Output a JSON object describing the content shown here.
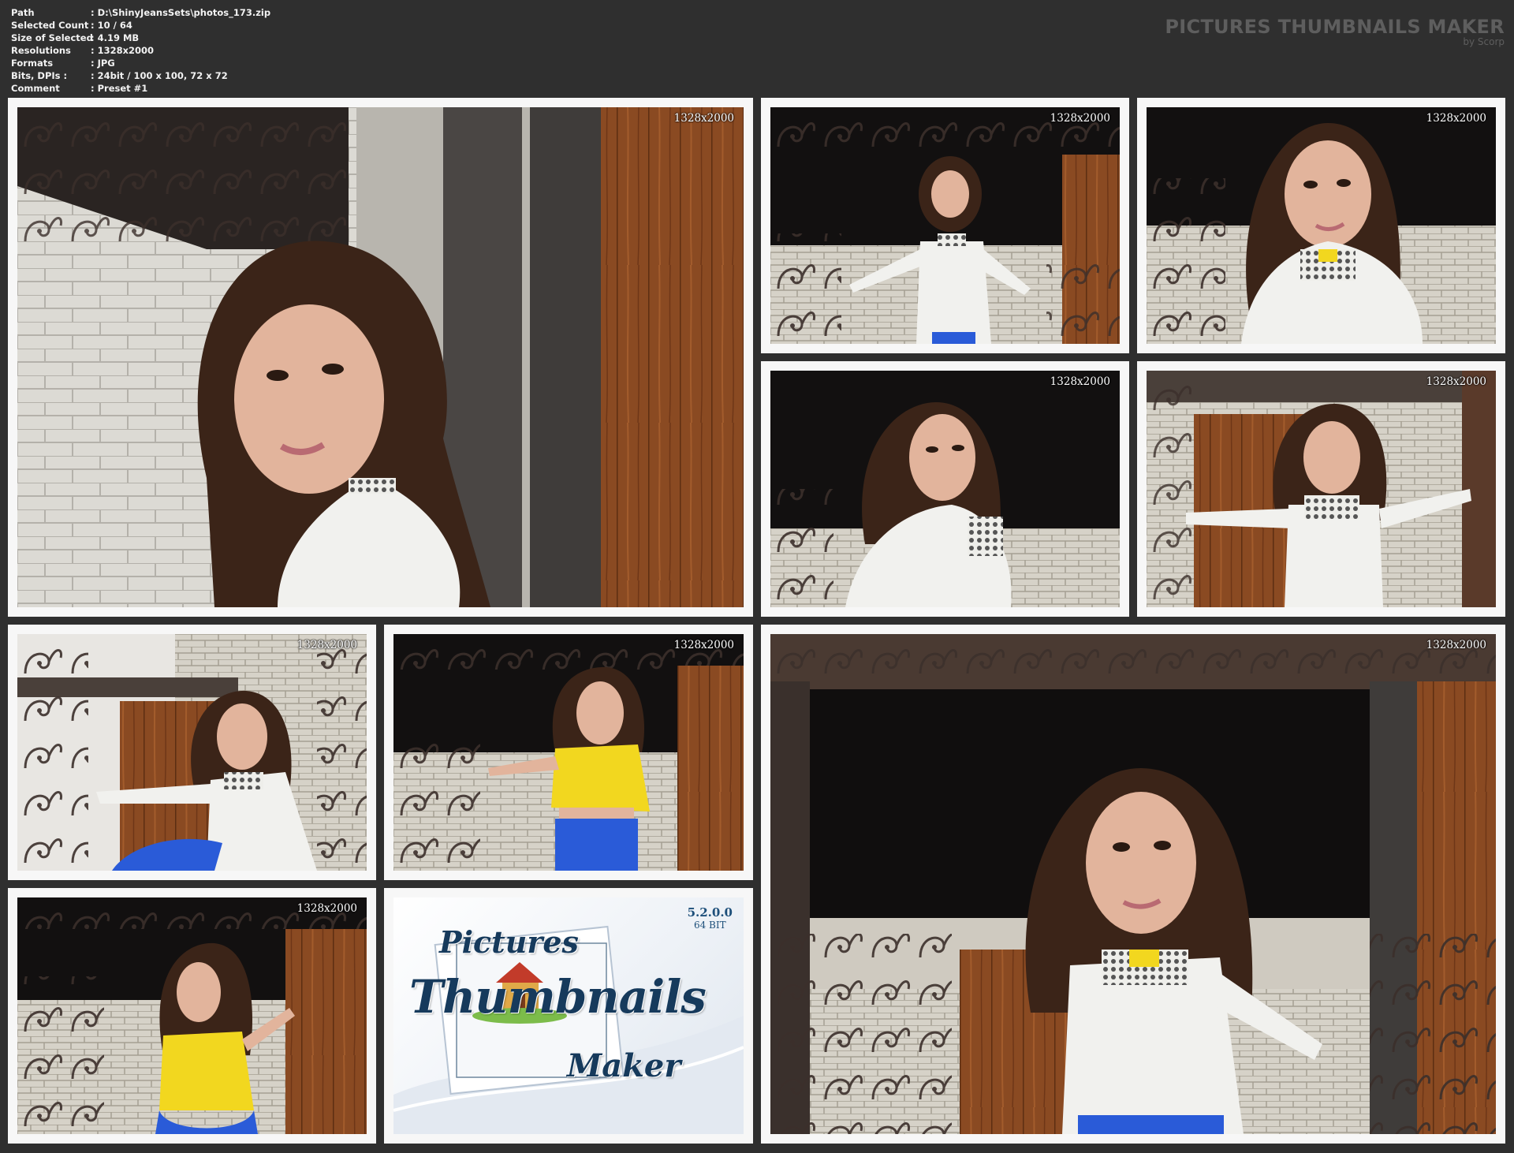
{
  "info": {
    "rows": [
      {
        "label": "Path",
        "value": ": D:\\ShinyJeansSets\\photos_173.zip"
      },
      {
        "label": "Selected Count",
        "value": ": 10 / 64"
      },
      {
        "label": "Size of Selected",
        "value": ": 4.19 MB"
      },
      {
        "label": "Resolutions",
        "value": ": 1328x2000"
      },
      {
        "label": "Formats",
        "value": ": JPG"
      },
      {
        "label": "Bits, DPIs :",
        "value": ": 24bit / 100 x 100, 72 x 72"
      },
      {
        "label": "Comment",
        "value": ": Preset #1"
      }
    ]
  },
  "brand": {
    "title": "PICTURES THUMBNAILS MAKER",
    "subtitle": "by Scorp"
  },
  "thumbnails": [
    {
      "resolution": "1328x2000"
    },
    {
      "resolution": "1328x2000"
    },
    {
      "resolution": "1328x2000"
    },
    {
      "resolution": "1328x2000"
    },
    {
      "resolution": "1328x2000"
    },
    {
      "resolution": "1328x2000"
    },
    {
      "resolution": "1328x2000"
    },
    {
      "resolution": "1328x2000"
    },
    {
      "resolution": "1328x2000"
    }
  ],
  "logo": {
    "version": "5.2.0.0",
    "bits": "64 BIT",
    "word1": "Pictures",
    "word2": "Thumbnails",
    "word3": "Maker"
  },
  "colors": {
    "background": "#2f2f2f",
    "frame": "#f7f7f7",
    "brand_text": "#5e5e5e",
    "jacket": "#f1f1ee",
    "jeans": "#2a5bd8",
    "top": "#f2d71f",
    "door": "#8a4a22"
  }
}
